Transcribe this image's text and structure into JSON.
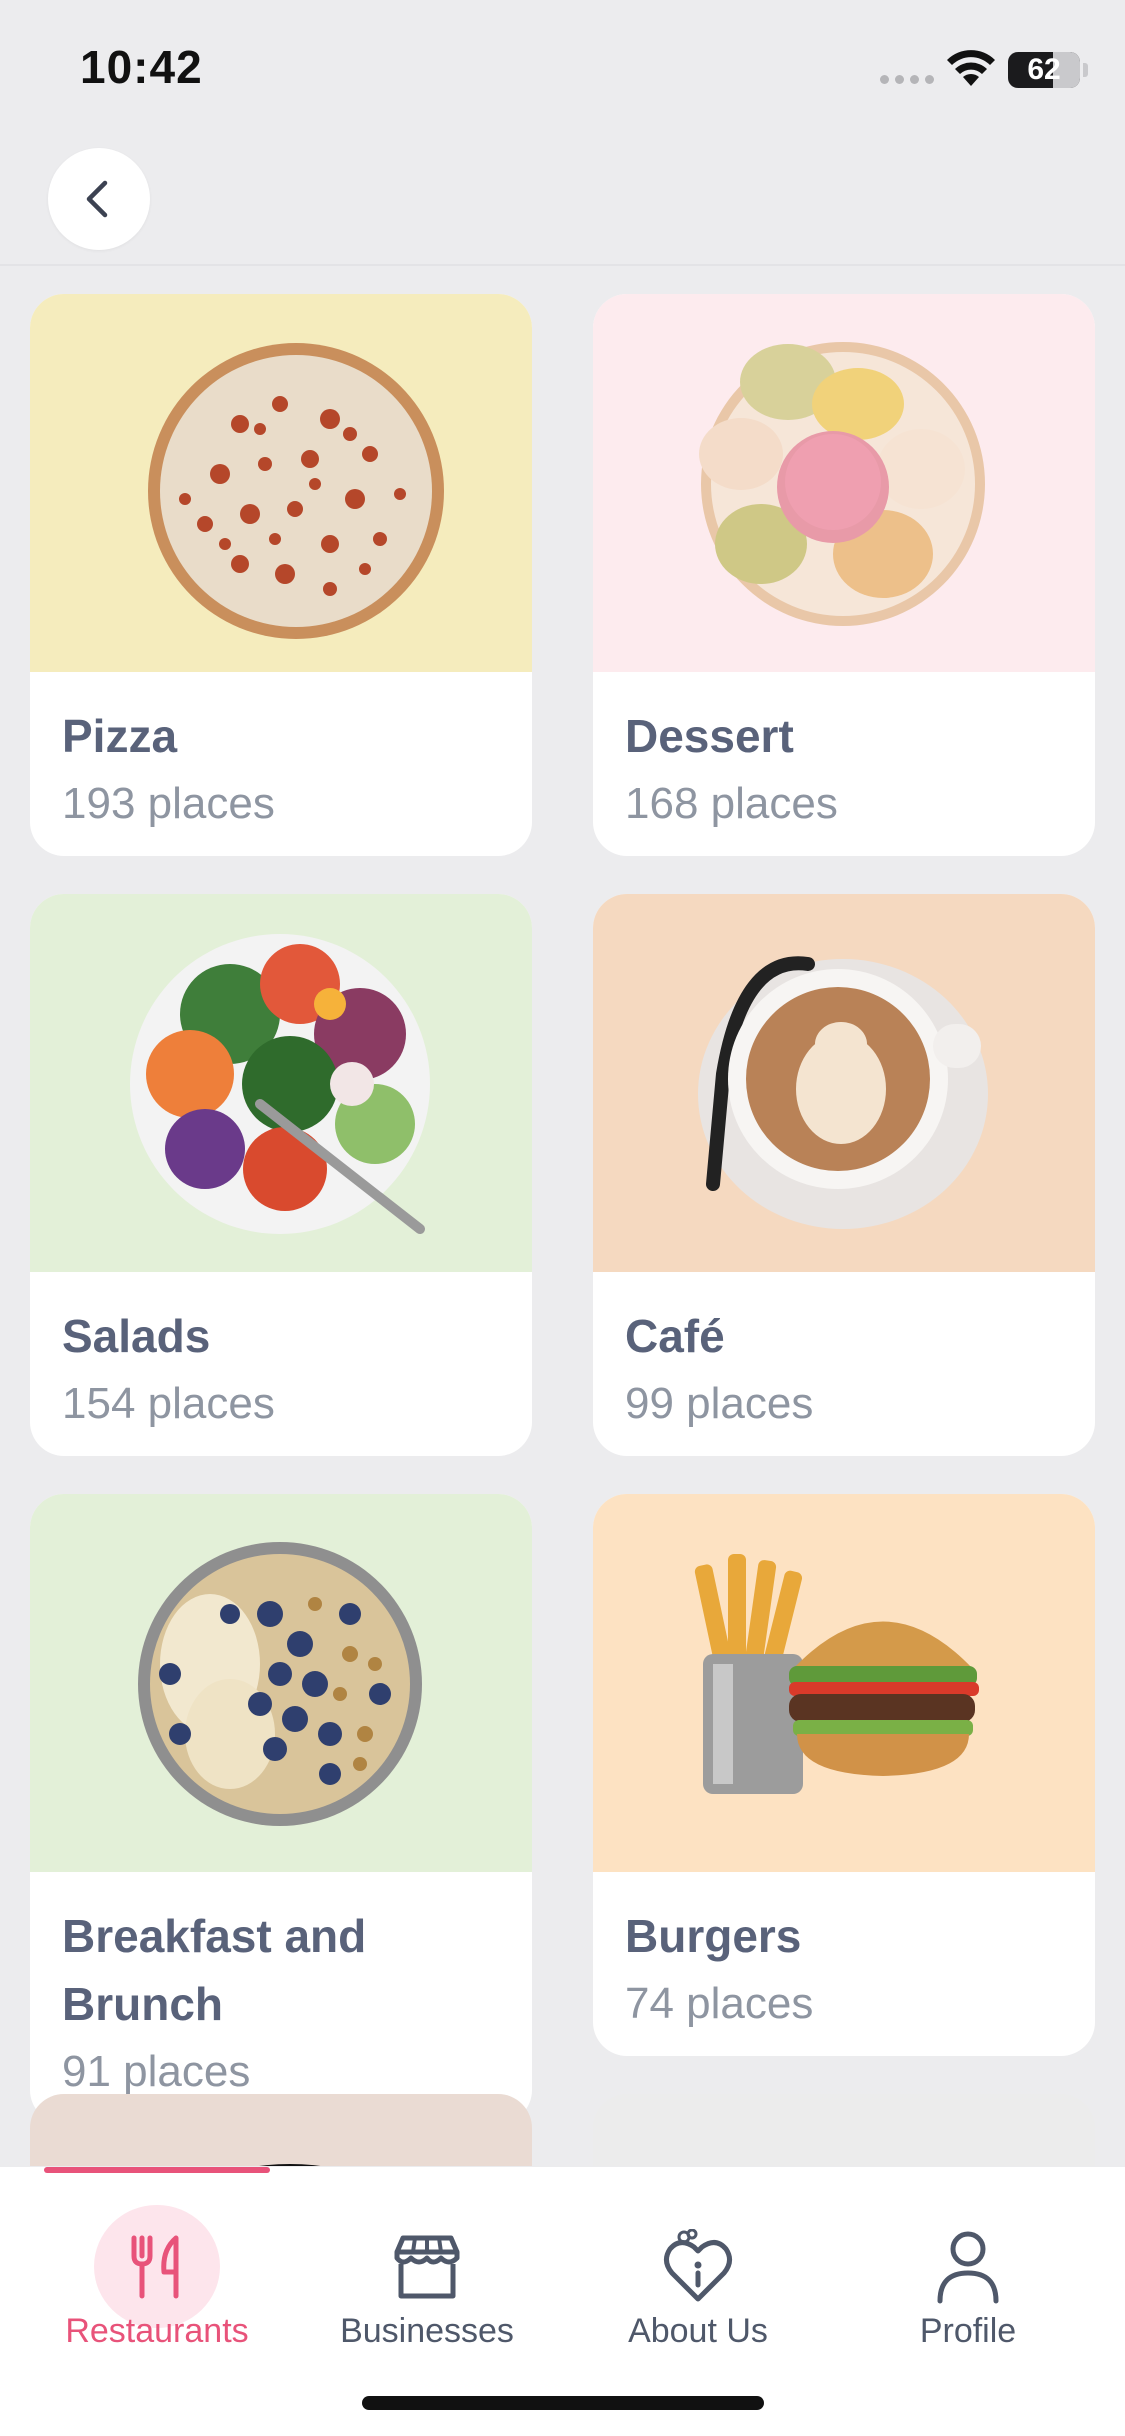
{
  "status_bar": {
    "time": "10:42",
    "battery": "62",
    "battery_level_percent": 62
  },
  "header": {
    "back_icon": "chevron-left-icon"
  },
  "categories": [
    {
      "title": "Pizza",
      "count": "193 places",
      "bg": "#f5ecbd"
    },
    {
      "title": "Dessert",
      "count": "168 places",
      "bg": "#fdebee"
    },
    {
      "title": "Salads",
      "count": "154 places",
      "bg": "#e3f0d8"
    },
    {
      "title": "Café",
      "count": "99 places",
      "bg": "#f5d9c0"
    },
    {
      "title": "Breakfast and Brunch",
      "count": "91 places",
      "bg": "#e3f0d8"
    },
    {
      "title": "Burgers",
      "count": "74 places",
      "bg": "#fde2c2"
    }
  ],
  "bottom_nav": {
    "items": [
      {
        "label": "Restaurants",
        "icon": "fork-knife-icon",
        "active": true
      },
      {
        "label": "Businesses",
        "icon": "storefront-icon",
        "active": false
      },
      {
        "label": "About Us",
        "icon": "heart-info-icon",
        "active": false
      },
      {
        "label": "Profile",
        "icon": "person-icon",
        "active": false
      }
    ],
    "accent": "#e8537a"
  }
}
